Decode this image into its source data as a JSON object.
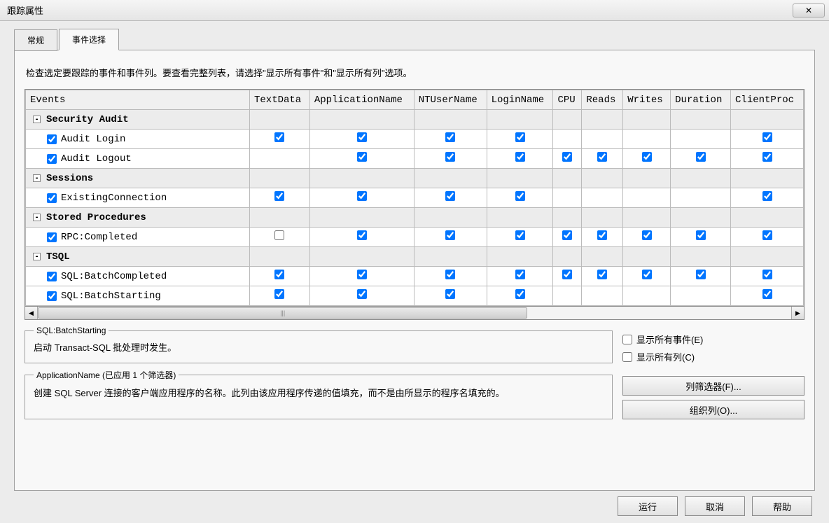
{
  "window": {
    "title": "跟踪属性",
    "close_glyph": "✕"
  },
  "tabs": {
    "general": "常规",
    "events": "事件选择"
  },
  "hint": "检查选定要跟踪的事件和事件列。要查看完整列表，请选择\"显示所有事件\"和\"显示所有列\"选项。",
  "columns": [
    "Events",
    "TextData",
    "ApplicationName",
    "NTUserName",
    "LoginName",
    "CPU",
    "Reads",
    "Writes",
    "Duration",
    "ClientProc"
  ],
  "groups": [
    {
      "name": "Security Audit",
      "expanded": true,
      "events": [
        {
          "name": "Audit Login",
          "row_checked": true,
          "cells": {
            "TextData": true,
            "ApplicationName": true,
            "NTUserName": true,
            "LoginName": true,
            "ClientProc": true
          }
        },
        {
          "name": "Audit Logout",
          "row_checked": true,
          "cells": {
            "ApplicationName": true,
            "NTUserName": true,
            "LoginName": true,
            "CPU": true,
            "Reads": true,
            "Writes": true,
            "Duration": true,
            "ClientProc": true
          }
        }
      ]
    },
    {
      "name": "Sessions",
      "expanded": true,
      "events": [
        {
          "name": "ExistingConnection",
          "row_checked": true,
          "cells": {
            "TextData": true,
            "ApplicationName": true,
            "NTUserName": true,
            "LoginName": true,
            "ClientProc": true
          }
        }
      ]
    },
    {
      "name": "Stored Procedures",
      "expanded": true,
      "events": [
        {
          "name": "RPC:Completed",
          "row_checked": true,
          "cells": {
            "TextData": false,
            "ApplicationName": true,
            "NTUserName": true,
            "LoginName": true,
            "CPU": true,
            "Reads": true,
            "Writes": true,
            "Duration": true,
            "ClientProc": true
          }
        }
      ]
    },
    {
      "name": "TSQL",
      "expanded": true,
      "events": [
        {
          "name": "SQL:BatchCompleted",
          "row_checked": true,
          "cells": {
            "TextData": true,
            "ApplicationName": true,
            "NTUserName": true,
            "LoginName": true,
            "CPU": true,
            "Reads": true,
            "Writes": true,
            "Duration": true,
            "ClientProc": true
          }
        },
        {
          "name": "SQL:BatchStarting",
          "row_checked": true,
          "cells": {
            "TextData": true,
            "ApplicationName": true,
            "NTUserName": true,
            "LoginName": true,
            "ClientProc": true
          }
        }
      ]
    }
  ],
  "info1": {
    "legend": "SQL:BatchStarting",
    "text": "启动 Transact-SQL 批处理时发生。"
  },
  "info2": {
    "legend": "ApplicationName (已应用 1 个筛选器)",
    "text": "创建 SQL Server 连接的客户端应用程序的名称。此列由该应用程序传递的值填充，而不是由所显示的程序名填充的。"
  },
  "options": {
    "show_all_events": "显示所有事件(E)",
    "show_all_columns": "显示所有列(C)",
    "show_all_events_checked": false,
    "show_all_columns_checked": false
  },
  "buttons": {
    "column_filters": "列筛选器(F)...",
    "organize_columns": "组织列(O)...",
    "run": "运行",
    "cancel": "取消",
    "help": "帮助"
  },
  "scroll": {
    "left": "◀",
    "right": "▶",
    "grip": "|||"
  }
}
